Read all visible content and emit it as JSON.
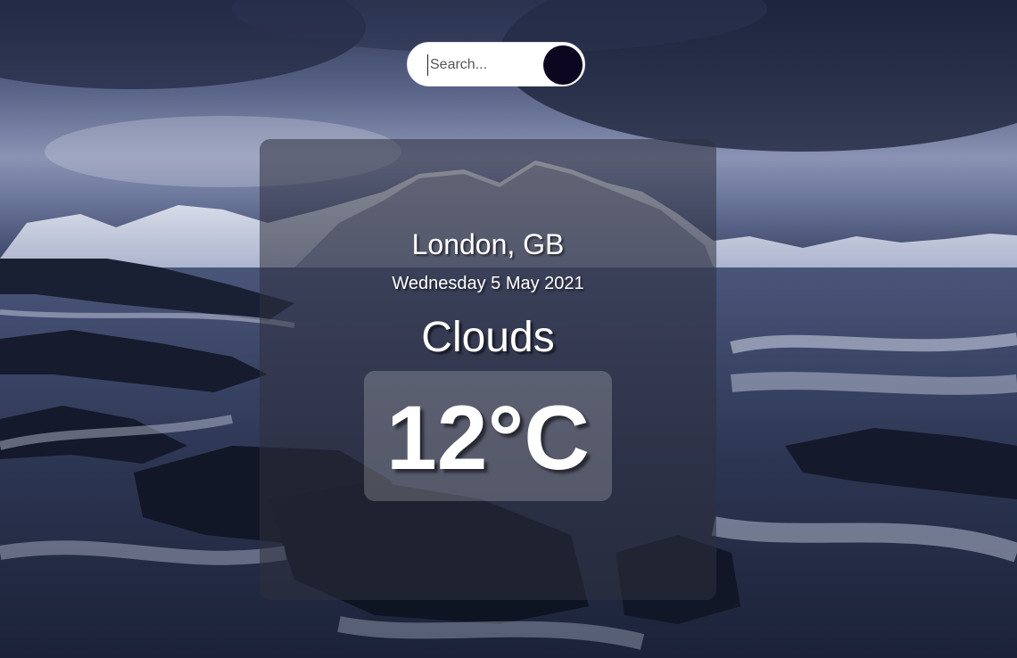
{
  "search": {
    "placeholder": "Search..."
  },
  "weather": {
    "location": "London, GB",
    "date": "Wednesday 5 May 2021",
    "condition": "Clouds",
    "temperature": "12°C"
  },
  "colors": {
    "search_button": "#0c0620",
    "card_background": "rgba(45,47,62,0.55)",
    "text": "#ffffff"
  }
}
